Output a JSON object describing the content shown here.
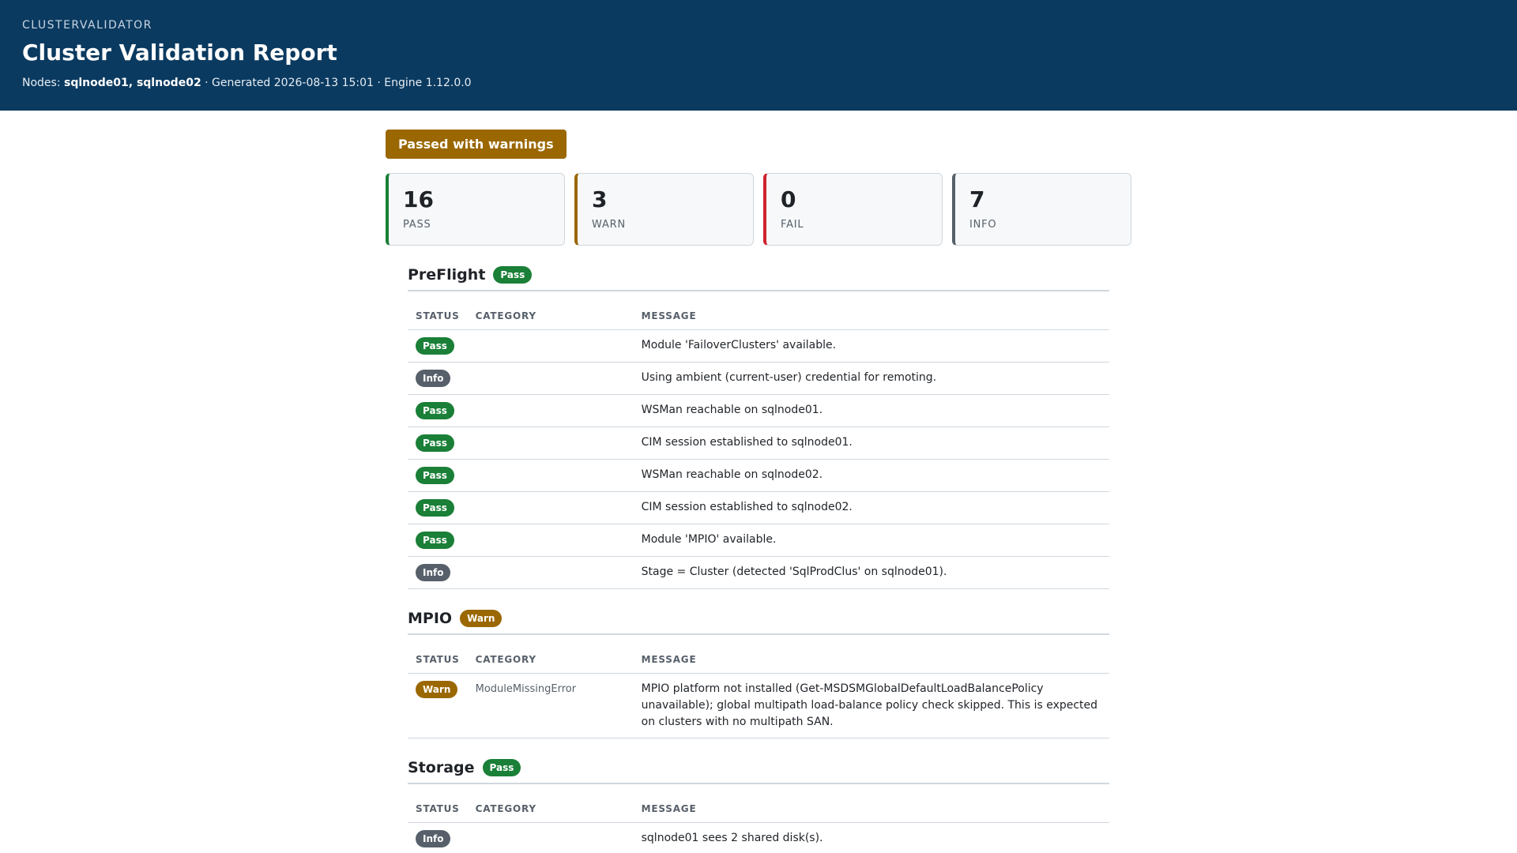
{
  "header": {
    "brand": "CLUSTERVALIDATOR",
    "title": "Cluster Validation Report",
    "nodes_label": "Nodes:",
    "nodes": "sqlnode01, sqlnode02",
    "meta_rest": "· Generated 2026-08-13 15:01 · Engine 1.12.0.0"
  },
  "overall": {
    "label": "Passed with warnings",
    "color": "#9a6700"
  },
  "summary": [
    {
      "count": "16",
      "label": "PASS",
      "kind": "pass"
    },
    {
      "count": "3",
      "label": "WARN",
      "kind": "warn"
    },
    {
      "count": "0",
      "label": "FAIL",
      "kind": "fail"
    },
    {
      "count": "7",
      "label": "INFO",
      "kind": "info"
    }
  ],
  "columns": {
    "status": "STATUS",
    "category": "CATEGORY",
    "message": "MESSAGE"
  },
  "sections": [
    {
      "title": "PreFlight",
      "status": "Pass",
      "rows": [
        {
          "status": "Pass",
          "category": "",
          "message": "Module 'FailoverClusters' available."
        },
        {
          "status": "Info",
          "category": "",
          "message": "Using ambient (current-user) credential for remoting."
        },
        {
          "status": "Pass",
          "category": "",
          "message": "WSMan reachable on sqlnode01."
        },
        {
          "status": "Pass",
          "category": "",
          "message": "CIM session established to sqlnode01."
        },
        {
          "status": "Pass",
          "category": "",
          "message": "WSMan reachable on sqlnode02."
        },
        {
          "status": "Pass",
          "category": "",
          "message": "CIM session established to sqlnode02."
        },
        {
          "status": "Pass",
          "category": "",
          "message": "Module 'MPIO' available."
        },
        {
          "status": "Info",
          "category": "",
          "message": "Stage = Cluster (detected 'SqlProdClus' on sqlnode01)."
        }
      ]
    },
    {
      "title": "MPIO",
      "status": "Warn",
      "rows": [
        {
          "status": "Warn",
          "category": "ModuleMissingError",
          "message": "MPIO platform not installed (Get-MSDSMGlobalDefaultLoadBalancePolicy unavailable); global multipath load-balance policy check skipped. This is expected on clusters with no multipath SAN."
        }
      ]
    },
    {
      "title": "Storage",
      "status": "Pass",
      "rows": [
        {
          "status": "Info",
          "category": "",
          "message": "sqlnode01 sees 2 shared disk(s)."
        }
      ]
    }
  ],
  "colors": {
    "header_bg": "#0b3a60",
    "pass": "#1a7f37",
    "warn": "#9a6700",
    "fail": "#cf222e",
    "info": "#57606a"
  }
}
